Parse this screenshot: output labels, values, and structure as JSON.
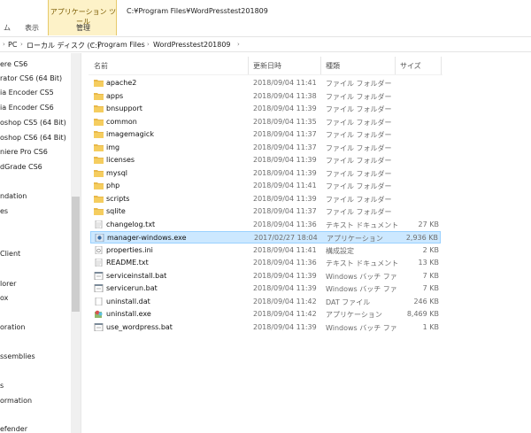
{
  "ribbon": {
    "context_group_label": "アプリケーション ツール",
    "context_tab": "管理",
    "tab_home": "ム",
    "tab_view": "表示"
  },
  "window": {
    "path_title": "C:¥Program Files¥WordPresstest201809"
  },
  "address": {
    "items": [
      "PC",
      "ローカル ディスク (C:)",
      "Program Files",
      "WordPresstest201809"
    ]
  },
  "nav": {
    "items": [
      "ere CS6",
      "rator CS6 (64 Bit)",
      "ia Encoder CS5",
      "ia Encoder CS6",
      "oshop CS5 (64 Bit)",
      "oshop CS6 (64 Bit)",
      "niere Pro CS6",
      "dGrade CS6",
      "ndation",
      "es",
      "Client",
      "lorer",
      "ox",
      "oration",
      "ssemblies",
      "s",
      "ormation",
      "efender"
    ]
  },
  "columns": {
    "name": "名前",
    "date": "更新日時",
    "type": "種類",
    "size": "サイズ"
  },
  "files": [
    {
      "name": "apache2",
      "date": "2018/09/04 11:41",
      "type": "ファイル フォルダー",
      "size": "",
      "icon": "folder-icon"
    },
    {
      "name": "apps",
      "date": "2018/09/04 11:38",
      "type": "ファイル フォルダー",
      "size": "",
      "icon": "folder-icon"
    },
    {
      "name": "bnsupport",
      "date": "2018/09/04 11:39",
      "type": "ファイル フォルダー",
      "size": "",
      "icon": "folder-icon"
    },
    {
      "name": "common",
      "date": "2018/09/04 11:35",
      "type": "ファイル フォルダー",
      "size": "",
      "icon": "folder-icon"
    },
    {
      "name": "imagemagick",
      "date": "2018/09/04 11:37",
      "type": "ファイル フォルダー",
      "size": "",
      "icon": "folder-icon"
    },
    {
      "name": "img",
      "date": "2018/09/04 11:37",
      "type": "ファイル フォルダー",
      "size": "",
      "icon": "folder-icon"
    },
    {
      "name": "licenses",
      "date": "2018/09/04 11:39",
      "type": "ファイル フォルダー",
      "size": "",
      "icon": "folder-icon"
    },
    {
      "name": "mysql",
      "date": "2018/09/04 11:39",
      "type": "ファイル フォルダー",
      "size": "",
      "icon": "folder-icon"
    },
    {
      "name": "php",
      "date": "2018/09/04 11:41",
      "type": "ファイル フォルダー",
      "size": "",
      "icon": "folder-icon"
    },
    {
      "name": "scripts",
      "date": "2018/09/04 11:39",
      "type": "ファイル フォルダー",
      "size": "",
      "icon": "folder-icon"
    },
    {
      "name": "sqlite",
      "date": "2018/09/04 11:37",
      "type": "ファイル フォルダー",
      "size": "",
      "icon": "folder-icon"
    },
    {
      "name": "changelog.txt",
      "date": "2018/09/04 11:36",
      "type": "テキスト ドキュメント",
      "size": "27 KB",
      "icon": "text-file-icon"
    },
    {
      "name": "manager-windows.exe",
      "date": "2017/02/27 18:04",
      "type": "アプリケーション",
      "size": "2,936 KB",
      "icon": "app-icon",
      "selected": true
    },
    {
      "name": "properties.ini",
      "date": "2018/09/04 11:41",
      "type": "構成設定",
      "size": "2 KB",
      "icon": "settings-file-icon"
    },
    {
      "name": "README.txt",
      "date": "2018/09/04 11:36",
      "type": "テキスト ドキュメント",
      "size": "13 KB",
      "icon": "text-file-icon"
    },
    {
      "name": "serviceinstall.bat",
      "date": "2018/09/04 11:39",
      "type": "Windows バッチ ファ",
      "size": "7 KB",
      "icon": "batch-file-icon"
    },
    {
      "name": "servicerun.bat",
      "date": "2018/09/04 11:39",
      "type": "Windows バッチ ファ",
      "size": "7 KB",
      "icon": "batch-file-icon"
    },
    {
      "name": "uninstall.dat",
      "date": "2018/09/04 11:42",
      "type": "DAT ファイル",
      "size": "246 KB",
      "icon": "dat-file-icon"
    },
    {
      "name": "uninstall.exe",
      "date": "2018/09/04 11:42",
      "type": "アプリケーション",
      "size": "8,469 KB",
      "icon": "installer-icon"
    },
    {
      "name": "use_wordpress.bat",
      "date": "2018/09/04 11:39",
      "type": "Windows バッチ ファ",
      "size": "1 KB",
      "icon": "batch-file-icon"
    }
  ],
  "colors": {
    "folder": "#e8b84a",
    "selection": "#cce8ff",
    "selection_border": "#99d1ff",
    "context_tab": "#fdf2c8"
  }
}
